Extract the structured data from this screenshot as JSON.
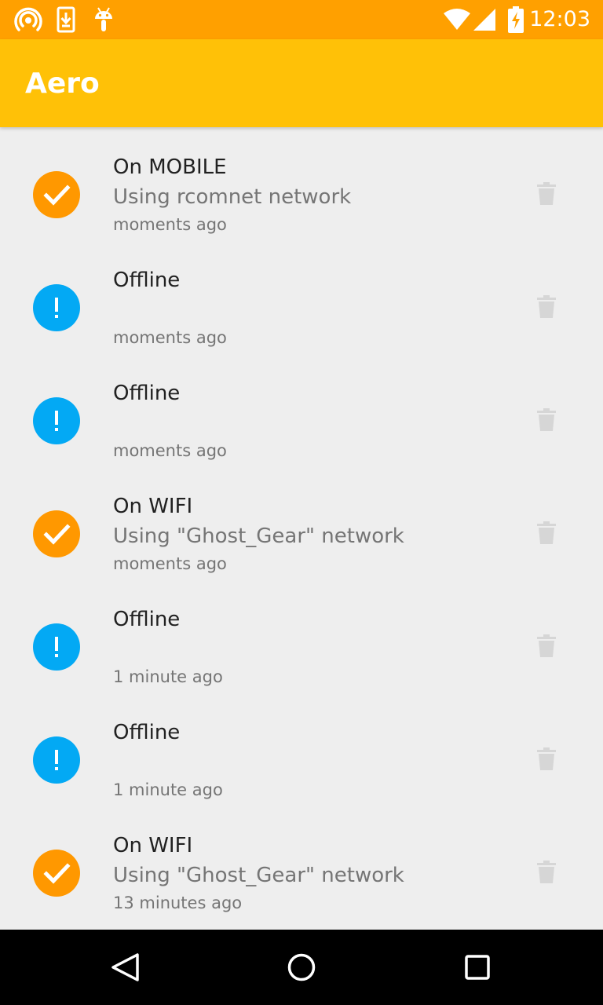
{
  "status_bar": {
    "time": "12:03",
    "background": "#FFA000",
    "left_icons": [
      "hotspot-icon",
      "download-icon",
      "android-icon"
    ],
    "right_icons": [
      "wifi-icon",
      "cell-signal-icon",
      "battery-charging-icon"
    ]
  },
  "app_bar": {
    "title": "Aero",
    "background": "#FFC107"
  },
  "colors": {
    "connected": "#FF9800",
    "offline": "#03A9F4",
    "delete_icon": "#D6D6D6",
    "list_background": "#EEEEEE"
  },
  "items": [
    {
      "status": "connected",
      "status_icon": "check-icon",
      "title": "On MOBILE",
      "subtitle": "Using rcomnet network",
      "time": "moments ago",
      "action_icon": "trash-icon"
    },
    {
      "status": "offline",
      "status_icon": "exclamation-icon",
      "title": "Offline",
      "subtitle": "",
      "time": "moments ago",
      "action_icon": "trash-icon"
    },
    {
      "status": "offline",
      "status_icon": "exclamation-icon",
      "title": "Offline",
      "subtitle": "",
      "time": "moments ago",
      "action_icon": "trash-icon"
    },
    {
      "status": "connected",
      "status_icon": "check-icon",
      "title": "On WIFI",
      "subtitle": "Using \"Ghost_Gear\" network",
      "time": "moments ago",
      "action_icon": "trash-icon"
    },
    {
      "status": "offline",
      "status_icon": "exclamation-icon",
      "title": "Offline",
      "subtitle": "",
      "time": "1 minute ago",
      "action_icon": "trash-icon"
    },
    {
      "status": "offline",
      "status_icon": "exclamation-icon",
      "title": "Offline",
      "subtitle": "",
      "time": "1 minute ago",
      "action_icon": "trash-icon"
    },
    {
      "status": "connected",
      "status_icon": "check-icon",
      "title": "On WIFI",
      "subtitle": "Using \"Ghost_Gear\" network",
      "time": "13 minutes ago",
      "action_icon": "trash-icon"
    }
  ],
  "nav_bar": {
    "buttons": [
      "back-icon",
      "home-icon",
      "recents-icon"
    ]
  }
}
